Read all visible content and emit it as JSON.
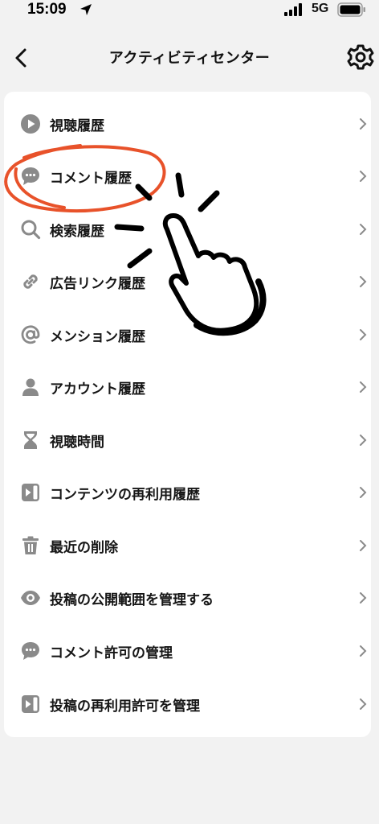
{
  "status_bar": {
    "time": "15:09",
    "network": "5G"
  },
  "nav": {
    "title": "アクティビティセンター"
  },
  "menu": {
    "items": [
      {
        "label": "視聴履歴",
        "icon": "play-circle-icon"
      },
      {
        "label": "コメント履歴",
        "icon": "comment-bubble-icon"
      },
      {
        "label": "検索履歴",
        "icon": "search-icon"
      },
      {
        "label": "広告リンク履歴",
        "icon": "link-icon"
      },
      {
        "label": "メンション履歴",
        "icon": "at-sign-icon"
      },
      {
        "label": "アカウント履歴",
        "icon": "person-icon"
      },
      {
        "label": "視聴時間",
        "icon": "hourglass-icon"
      },
      {
        "label": "コンテンツの再利用履歴",
        "icon": "play-box-icon"
      },
      {
        "label": "最近の削除",
        "icon": "trash-icon"
      },
      {
        "label": "投稿の公開範囲を管理する",
        "icon": "eye-icon"
      },
      {
        "label": "コメント許可の管理",
        "icon": "comment-bubble-icon"
      },
      {
        "label": "投稿の再利用許可を管理",
        "icon": "play-box-icon"
      }
    ]
  },
  "colors": {
    "icon": "#8a8a8a",
    "annotation_circle": "#e8522a",
    "chevron": "#8a8a8a"
  }
}
